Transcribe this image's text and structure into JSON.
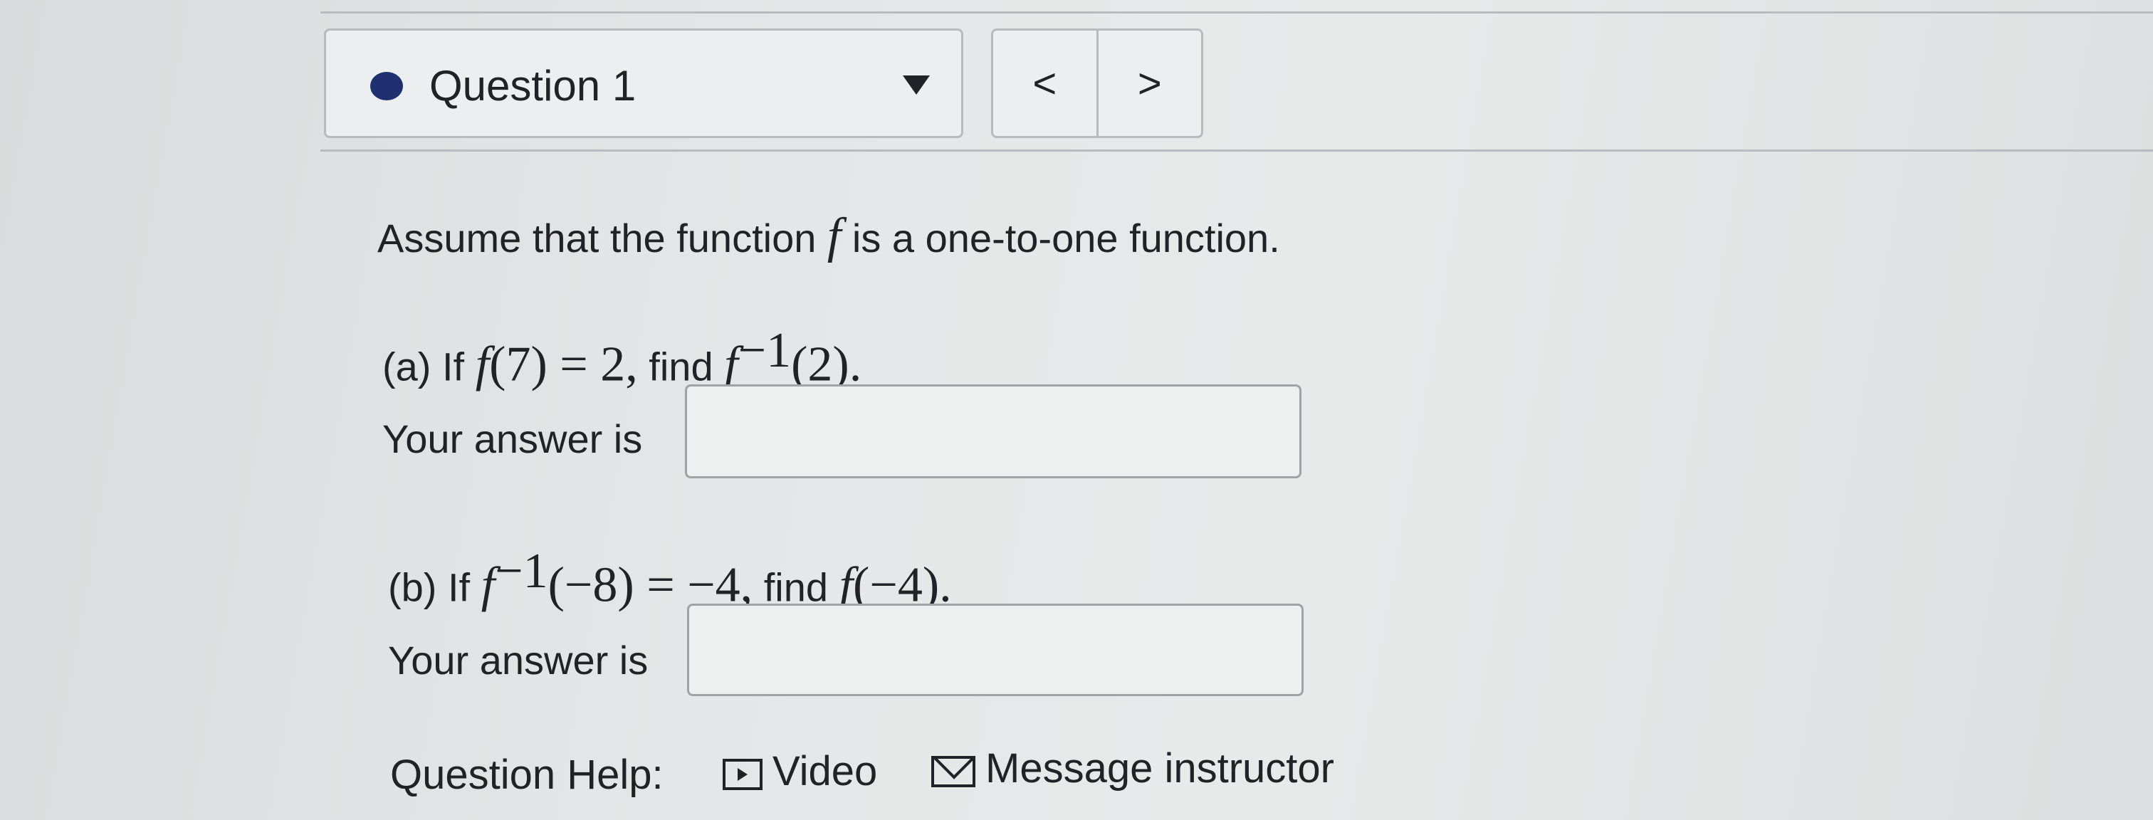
{
  "header": {
    "question_label": "Question 1",
    "prev_label": "<",
    "next_label": ">"
  },
  "question": {
    "prompt_pre": "Assume that the function ",
    "prompt_var": "f",
    "prompt_post": " is a one-to-one function.",
    "part_a": {
      "prefix": "(a) If ",
      "math_fn": "f",
      "math_expr": "(7) = 2,",
      "mid": " find ",
      "math_fn2": "f",
      "math_sup": "−1",
      "math_expr2": "(2).",
      "answer_label": "Your answer is",
      "answer_value": ""
    },
    "part_b": {
      "prefix": "(b) If ",
      "math_fn": "f",
      "math_sup": "−1",
      "math_expr": "(−8) = −4,",
      "mid": " find ",
      "math_fn2": "f",
      "math_expr2": "(−4).",
      "answer_label": "Your answer is",
      "answer_value": ""
    }
  },
  "help": {
    "label": "Question Help:",
    "video_label": "Video",
    "video_icon": "video-icon",
    "message_label": "Message instructor",
    "message_icon": "envelope-icon"
  },
  "colors": {
    "status_dot": "#1f2f6f",
    "background": "#e4e6e7"
  }
}
